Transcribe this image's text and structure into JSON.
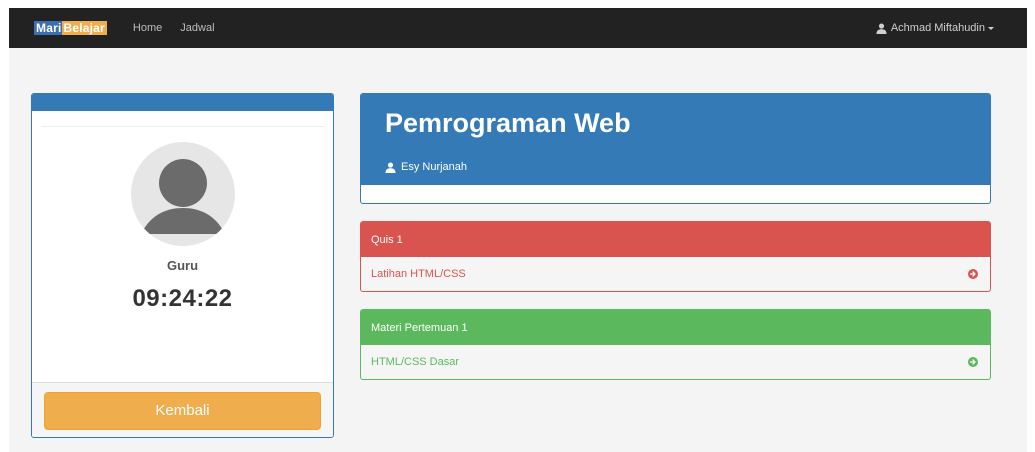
{
  "navbar": {
    "brand_part1": "Mari",
    "brand_part2": "Belajar",
    "links": [
      "Home",
      "Jadwal"
    ],
    "user_name": "Achmad Miftahudin",
    "user_icon": "user-icon"
  },
  "profile": {
    "role": "Guru",
    "clock": "09:24:22",
    "back_button": "Kembali",
    "avatar_icon": "avatar-placeholder-icon"
  },
  "course": {
    "title": "Pemrograman Web",
    "teacher": "Esy Nurjanah",
    "teacher_icon": "user-icon"
  },
  "activities": [
    {
      "heading": "Quis 1",
      "item": "Latihan HTML/CSS",
      "color": "#d9534f",
      "icon": "arrow-circle-right-icon"
    },
    {
      "heading": "Materi Pertemuan 1",
      "item": "HTML/CSS Dasar",
      "color": "#5cb85c",
      "icon": "arrow-circle-right-icon"
    }
  ],
  "colors": {
    "navbar": "#222222",
    "primary": "#337ab7",
    "warning": "#f0ad4e",
    "danger": "#d9534f",
    "success": "#5cb85c"
  }
}
